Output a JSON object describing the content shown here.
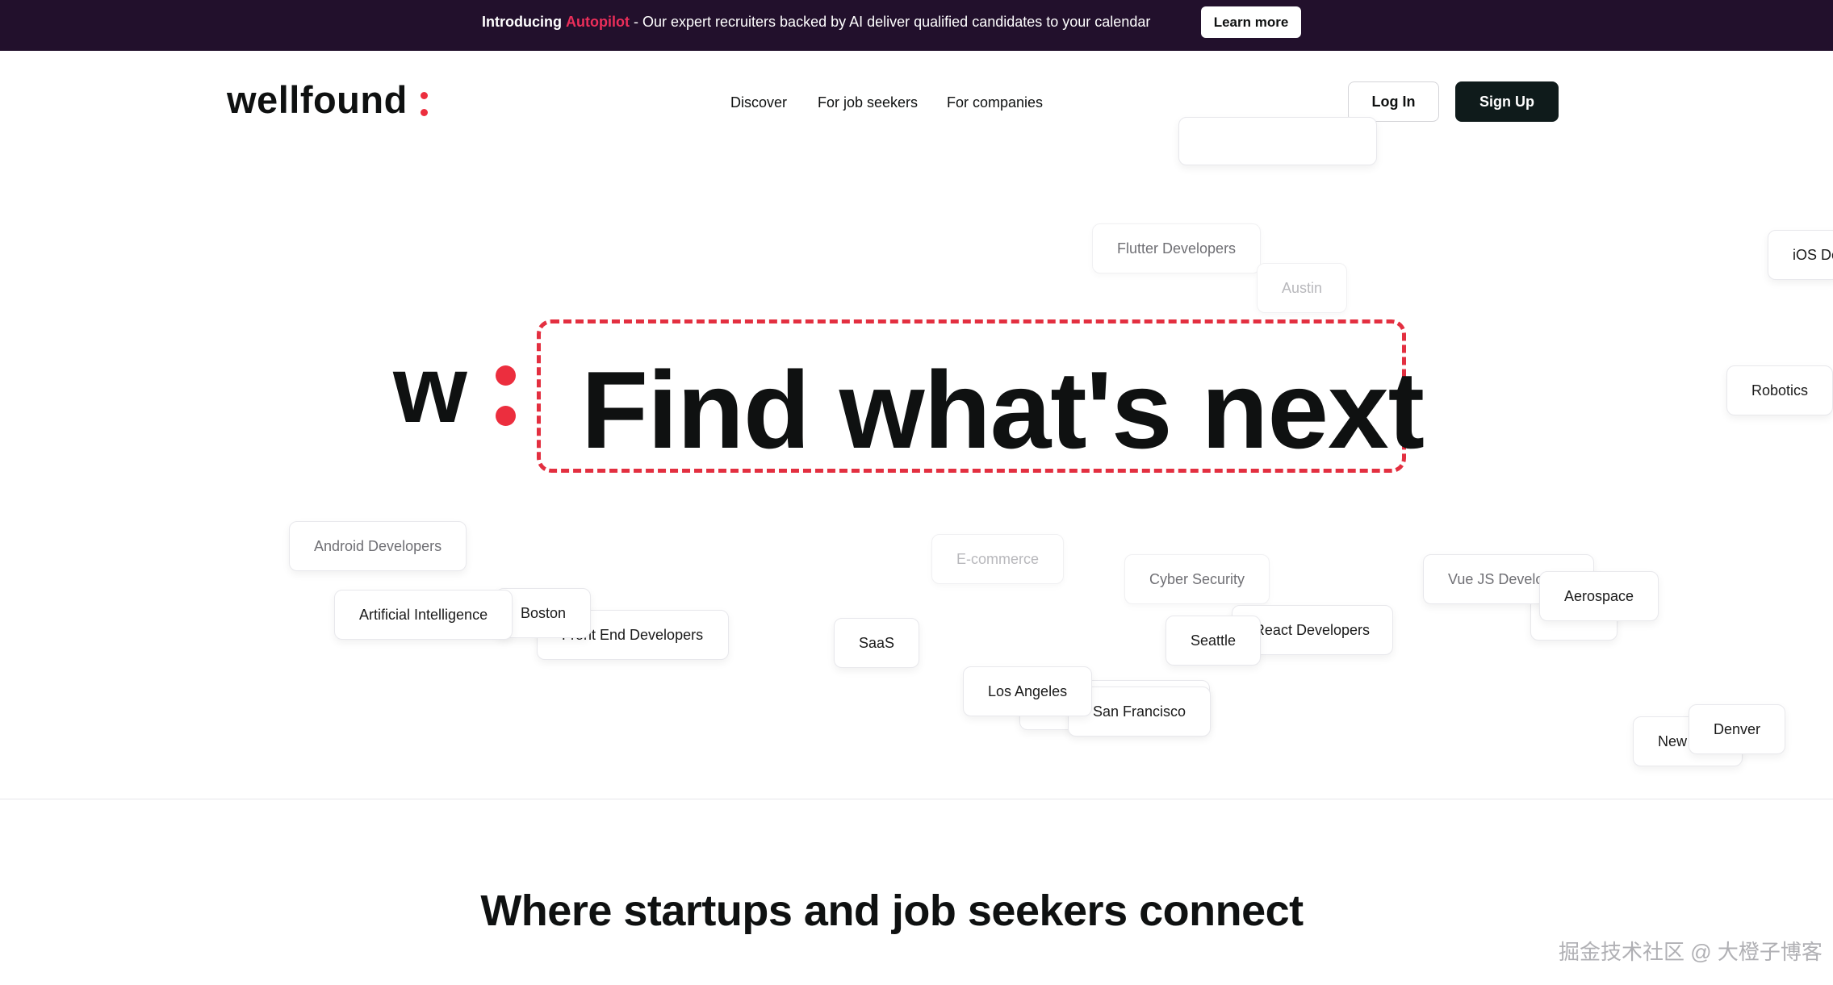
{
  "announcement": {
    "intro": "Introducing",
    "brand": "Autopilot",
    "message": "- Our expert recruiters backed by AI deliver qualified candidates to your calendar",
    "button_label": "Learn more"
  },
  "header": {
    "logo_text": "wellfound",
    "nav": [
      "Discover",
      "For job seekers",
      "For companies"
    ],
    "login_label": "Log In",
    "signup_label": "Sign Up"
  },
  "tags": [
    "Flutter Developers",
    "Austin",
    "iOS De",
    "Robotics",
    "Android Developers",
    "Boston",
    "Artificial Intelligence",
    "Front End Developers",
    "E-commerce",
    "SaaS",
    "Cyber Security",
    "React Developers",
    "Seattle",
    "Vue JS Develo",
    "Aerospace",
    "Los Angeles",
    "San Francisco",
    "New",
    "Denver"
  ],
  "hero": {
    "logo_letter": "w",
    "title": "Find what's next"
  },
  "section": {
    "title": "Where startups and job seekers connect"
  },
  "watermark": "掘金技术社区 @ 大橙子博客",
  "colors": {
    "announcement_bg": "#22102c",
    "brand_red": "#ec2e3e",
    "primary_dark": "#0f1b1b"
  }
}
